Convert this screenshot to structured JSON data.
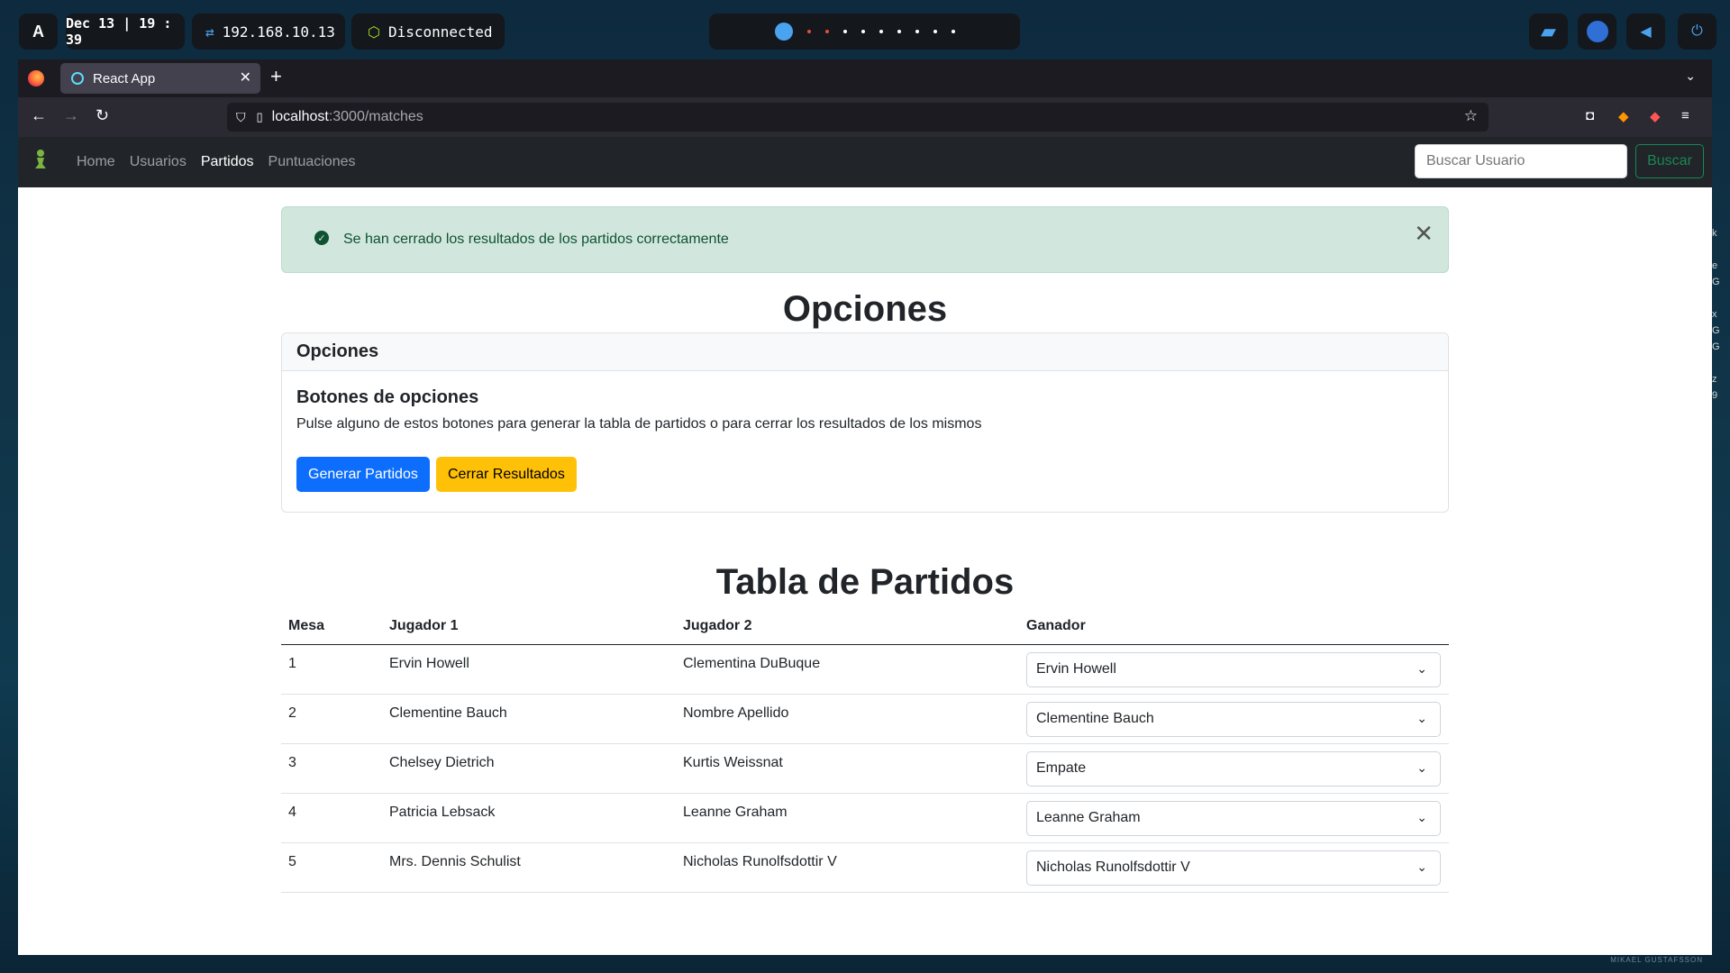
{
  "desktop": {
    "logo": "A",
    "datetime": "Dec 13 | 19 : 39",
    "ip": "192.168.10.13",
    "vpn_status": "Disconnected",
    "watermark": "MIKAEL GUSTAFSSON"
  },
  "browser": {
    "tab_title": "React App",
    "url_host": "localhost",
    "url_path": ":3000/matches"
  },
  "app": {
    "nav": [
      "Home",
      "Usuarios",
      "Partidos",
      "Puntuaciones"
    ],
    "active_nav": "Partidos",
    "search_placeholder": "Buscar Usuario",
    "search_button": "Buscar",
    "alert": "Se han cerrado los resultados de los partidos correctamente",
    "options_heading": "Opciones",
    "card_header": "Opciones",
    "card_title": "Botones de opciones",
    "card_text": "Pulse alguno de estos botones para generar la tabla de partidos o para cerrar los resultados de los mismos",
    "btn_generate": "Generar Partidos",
    "btn_close": "Cerrar Resultados",
    "table_heading": "Tabla de Partidos",
    "columns": [
      "Mesa",
      "Jugador 1",
      "Jugador 2",
      "Ganador"
    ],
    "rows": [
      {
        "mesa": "1",
        "j1": "Ervin Howell",
        "j2": "Clementina DuBuque",
        "winner": "Ervin Howell"
      },
      {
        "mesa": "2",
        "j1": "Clementine Bauch",
        "j2": "Nombre Apellido",
        "winner": "Clementine Bauch"
      },
      {
        "mesa": "3",
        "j1": "Chelsey Dietrich",
        "j2": "Kurtis Weissnat",
        "winner": "Empate"
      },
      {
        "mesa": "4",
        "j1": "Patricia Lebsack",
        "j2": "Leanne Graham",
        "winner": "Leanne Graham"
      },
      {
        "mesa": "5",
        "j1": "Mrs. Dennis Schulist",
        "j2": "Nicholas Runolfsdottir V",
        "winner": "Nicholas Runolfsdottir V"
      }
    ]
  },
  "colors": {
    "alert_bg": "#d1e7dd",
    "primary": "#0d6efd",
    "warning": "#ffc107",
    "navbar": "#212529"
  }
}
